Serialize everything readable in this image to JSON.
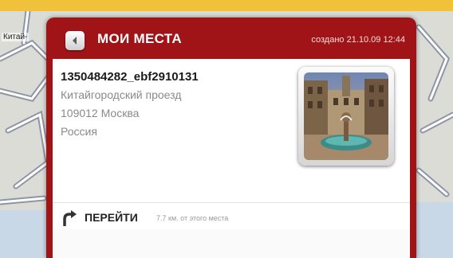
{
  "colors": {
    "panel_red": "#a01418",
    "top_strip": "#f0c13a",
    "map_background": "#dcdcd6"
  },
  "map": {
    "label": "Китай-"
  },
  "header": {
    "back_icon": "back-arrow-icon",
    "title": "МОИ МЕСТА",
    "created": "создано 21.10.09 12:44"
  },
  "place": {
    "name": "1350484282_ebf2910131",
    "street": "Китайгородский проезд",
    "city": "109012 Москва",
    "country": "Россия",
    "photo": "fountain-courtyard-photo"
  },
  "goto": {
    "icon": "turn-arrow-icon",
    "label": "ПЕРЕЙТИ",
    "distance": "7.7 км. от этого места"
  }
}
